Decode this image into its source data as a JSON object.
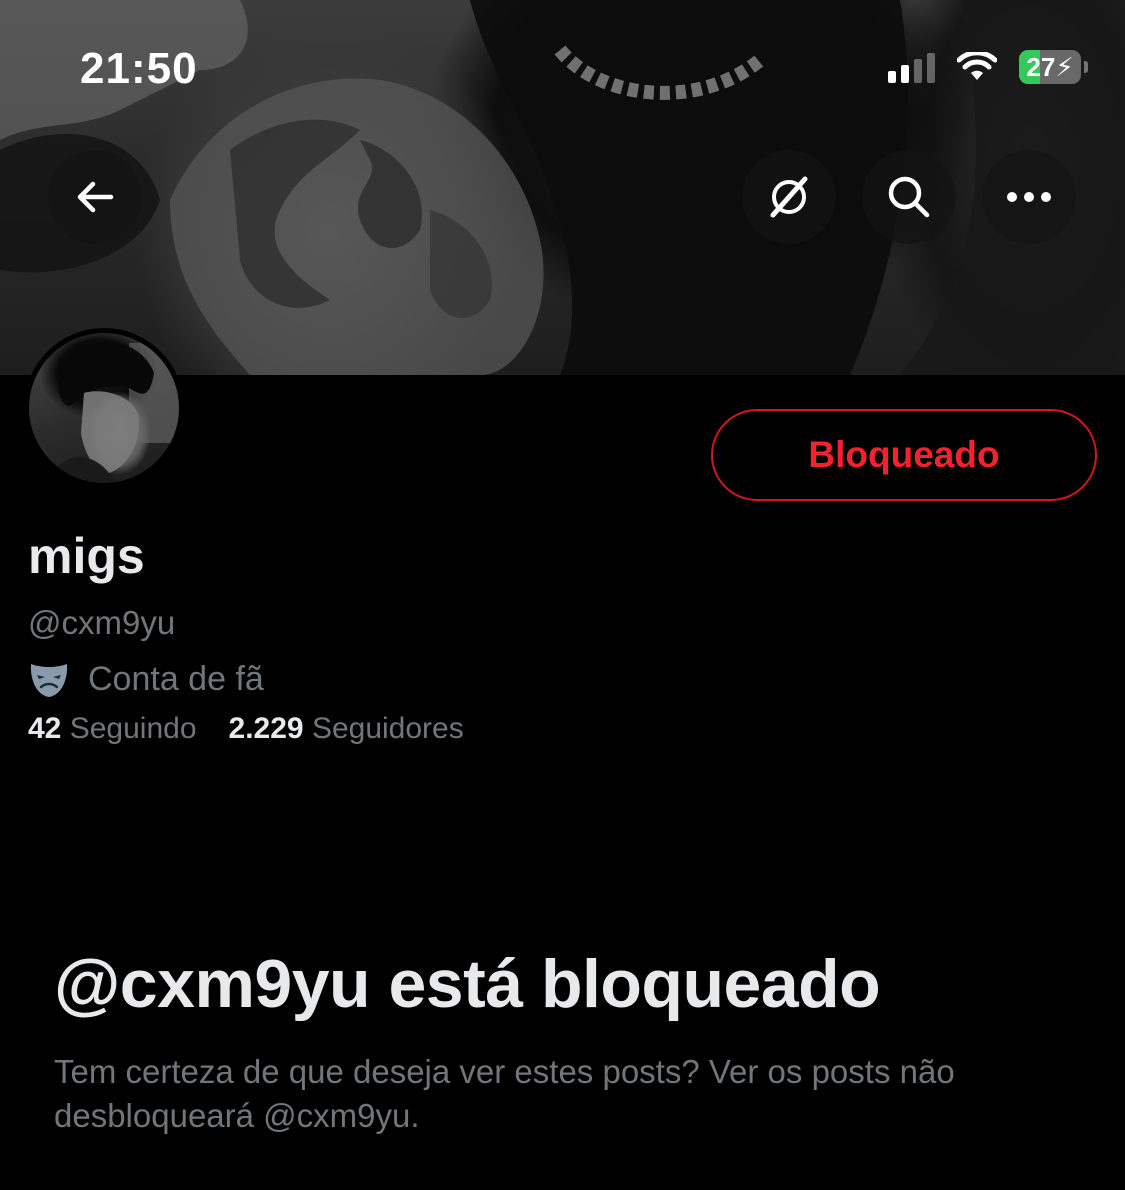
{
  "status_bar": {
    "time": "21:50",
    "battery_level": "27",
    "battery_charging": true,
    "wifi": "wifi-icon",
    "signal_bars_active": 2,
    "signal_bars_total": 4
  },
  "header": {
    "back_icon": "arrow-left-icon",
    "grok_icon": "grok-icon",
    "search_icon": "search-icon",
    "more_icon": "more-horizontal-icon"
  },
  "profile": {
    "display_name": "migs",
    "handle": "@cxm9yu",
    "category_icon": "theater-mask-icon",
    "category": "Conta de fã",
    "following_count": "42",
    "following_label": "Seguindo",
    "followers_count": "2.229",
    "followers_label": "Seguidores",
    "blocked_button_label": "Bloqueado"
  },
  "blocked_notice": {
    "title": "@cxm9yu está bloqueado",
    "description": "Tem certeza de que deseja ver estes posts? Ver os posts não desbloqueará @cxm9yu."
  },
  "colors": {
    "background": "#000000",
    "primary_text": "#e7e9ea",
    "secondary_text": "#71767b",
    "blocked_red": "#f4212e",
    "battery_green": "#34c759"
  }
}
